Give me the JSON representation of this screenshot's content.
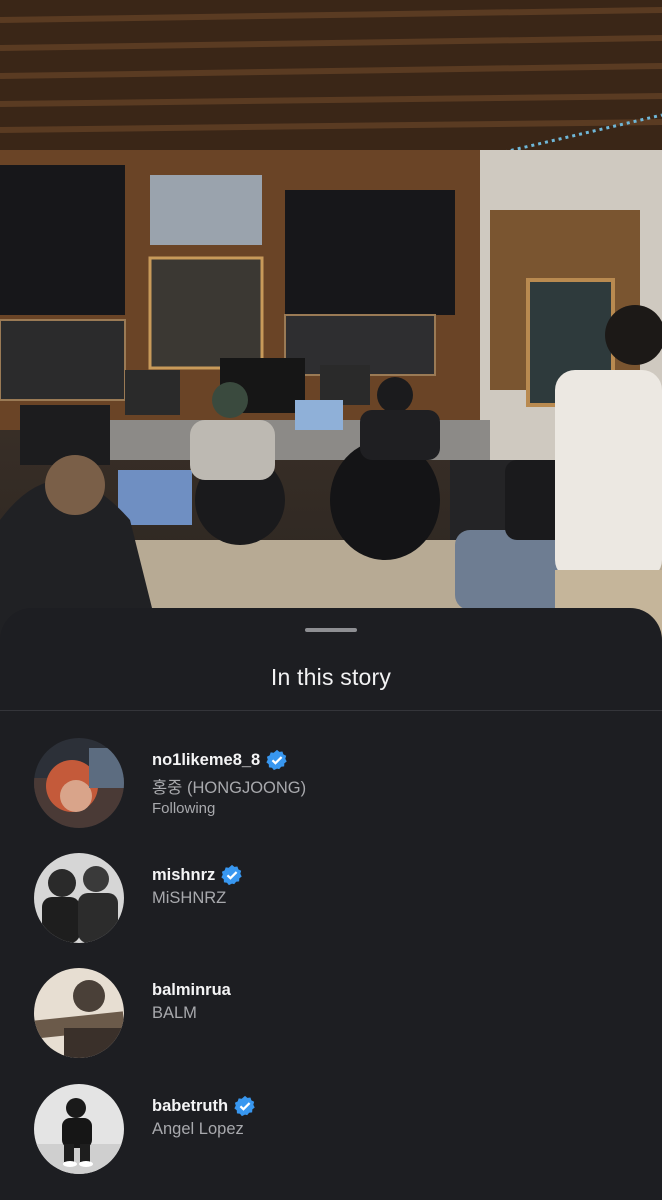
{
  "sheet": {
    "title": "In this story"
  },
  "users": [
    {
      "username": "no1likeme8_8",
      "fullname": "홍중 (HONGJOONG)",
      "status": "Following",
      "verified": true
    },
    {
      "username": "mishnrz",
      "fullname": "MiSHNRZ",
      "status": "",
      "verified": true
    },
    {
      "username": "balminrua",
      "fullname": "BALM",
      "status": "",
      "verified": false
    },
    {
      "username": "babetruth",
      "fullname": "Angel Lopez",
      "status": "",
      "verified": true
    }
  ],
  "colors": {
    "background": "#1d1e22",
    "verified": "#3897f0",
    "primary_text": "#f4f4f5",
    "secondary_text": "#a8a9ad"
  }
}
